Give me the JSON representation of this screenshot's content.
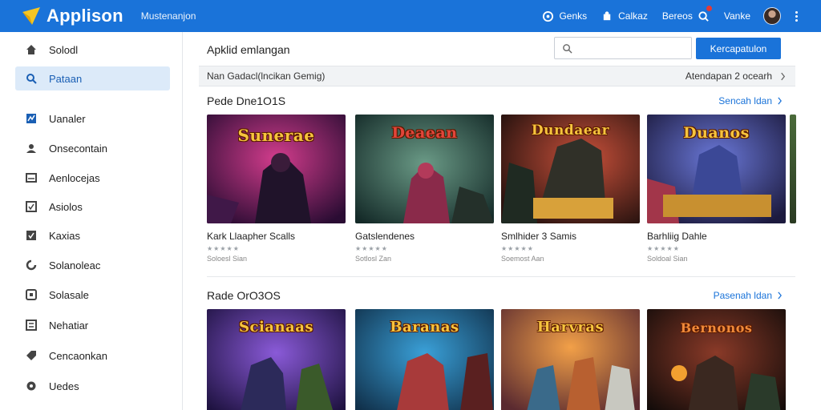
{
  "app": {
    "name": "Applison",
    "subtitle": "Mustenanjon"
  },
  "topbar": {
    "actions": [
      {
        "label": "Genks",
        "icon": "chat-icon"
      },
      {
        "label": "Calkaz",
        "icon": "puzzle-icon"
      },
      {
        "label": "Bereos",
        "icon": "search-icon"
      },
      {
        "label": "Vanke",
        "icon": "gear-icon"
      }
    ],
    "notification_color": "#e53935"
  },
  "sidebar": {
    "items": [
      {
        "label": "Solodl",
        "icon": "home-icon",
        "active": false
      },
      {
        "label": "Pataan",
        "icon": "search-icon",
        "active": true
      },
      {
        "label": "Uanaler",
        "icon": "chart-icon",
        "active": false
      },
      {
        "label": "Onsecontain",
        "icon": "user-icon",
        "active": false
      },
      {
        "label": "Aenlocejas",
        "icon": "inbox-icon",
        "active": false
      },
      {
        "label": "Asiolos",
        "icon": "check-icon",
        "active": false
      },
      {
        "label": "Kaxias",
        "icon": "checkbox-icon",
        "active": false
      },
      {
        "label": "Solanoleac",
        "icon": "refresh-icon",
        "active": false
      },
      {
        "label": "Solasale",
        "icon": "square-icon",
        "active": false
      },
      {
        "label": "Nehatiar",
        "icon": "list-icon",
        "active": false
      },
      {
        "label": "Cencaonkan",
        "icon": "tag-icon",
        "active": false
      },
      {
        "label": "Uedes",
        "icon": "circle-icon",
        "active": false
      }
    ]
  },
  "main": {
    "title": "Apklid emlangan",
    "search_placeholder": "",
    "primary_button": "Kercapatulon",
    "filter": {
      "left": "Nan Gadacl(lncikan Gemig)",
      "right": "Atendapan 2 ocearh"
    },
    "sections": [
      {
        "title": "Pede Dne1O1S",
        "see_all": "Sencah ldan",
        "cards": [
          {
            "title": "Kark Llaapher Scalls",
            "stars": "★★★★★",
            "meta": "Soloesl Sian",
            "art": "Sunerae"
          },
          {
            "title": "Gatslendenes",
            "stars": "★★★★★",
            "meta": "Sotlosl Zan",
            "art": "Deaean"
          },
          {
            "title": "Smlhider 3 Samis",
            "stars": "★★★★★",
            "meta": "Soemost Aan",
            "art": "Dundaear"
          },
          {
            "title": "Barhliig Dahle",
            "stars": "★★★★★",
            "meta": "Soldoal Sian",
            "art": "Duanos"
          }
        ]
      },
      {
        "title": "Rade OrO3OS",
        "see_all": "Pasenah ldan",
        "cards": [
          {
            "art": "Scianaas"
          },
          {
            "art": "Baranas"
          },
          {
            "art": "Harvras"
          },
          {
            "art": "Bernonos"
          }
        ]
      }
    ]
  },
  "colors": {
    "accent": "#1a73d9",
    "active_bg": "#dceaf9"
  }
}
